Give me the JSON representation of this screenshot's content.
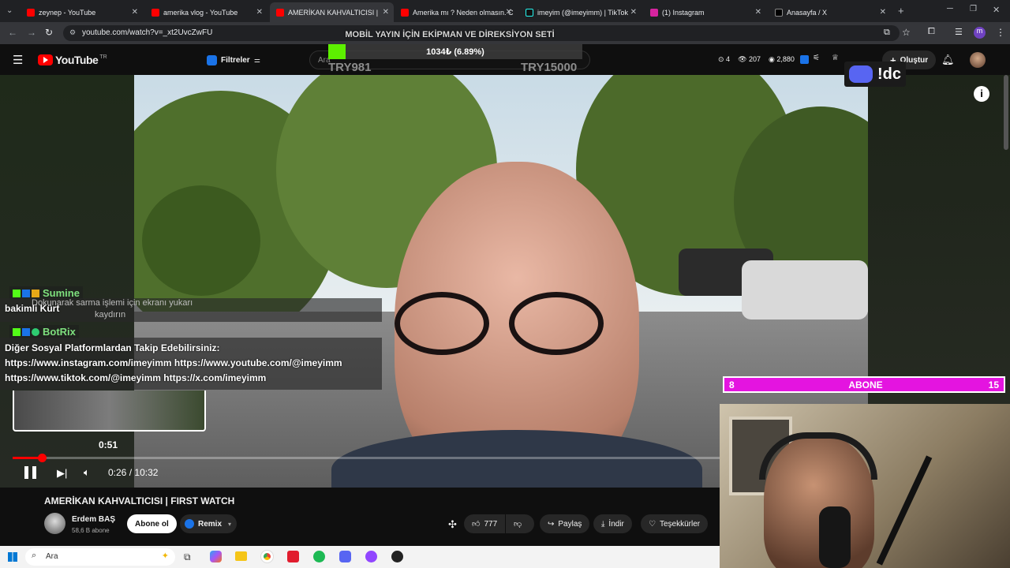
{
  "browser": {
    "tabs": [
      {
        "title": "zeynep - YouTube",
        "color": "#ff0000"
      },
      {
        "title": "amerika vlog - YouTube",
        "color": "#ff0000"
      },
      {
        "title": "AMERİKAN KAHVALTICISI |",
        "color": "#ff0000"
      },
      {
        "title": "Amerika mı ? Neden olmasın. C",
        "color": "#ff0000"
      },
      {
        "title": "imeyim (@imeyimm) | TikTok",
        "color": "#111111"
      },
      {
        "title": "(1) Instagram",
        "color": "#d6249f"
      },
      {
        "title": "Anasayfa / X",
        "color": "#000000"
      }
    ],
    "url": "youtube.com/watch?v=_xt2UvcZwFU"
  },
  "youtube": {
    "logo": "YouTube",
    "region": "TR",
    "filter_label": "Filtreler",
    "search_placeholder": "Ara",
    "stats": {
      "likes": "4",
      "views": "207",
      "viewers": "2,880"
    },
    "create_label": "Oluştur"
  },
  "stream_overlay": {
    "goal_title": "MOBİL YAYIN İÇİN EKİPMAN VE DİREKSİYON SETİ",
    "goal_progress_text": "1034₺ (6.89%)",
    "goal_progress": 0.0689,
    "goal_min": "TRY981",
    "goal_max": "TRY15000",
    "discord_label": "!dc",
    "sub_bar": {
      "left": "8",
      "label": "ABONE",
      "right": "15"
    }
  },
  "chat": {
    "user1": "Sumine",
    "hint": "Ekranı sarma işlemi için ekranı yukarı kaydırın",
    "hint_line1": "Dokunarak sarma işlemi için ekranı yukarı",
    "hint_line2": "kaydırın",
    "msg1": "bakimli Kürt",
    "user2": "BotRix",
    "msg2_line1": "Diğer Sosyal Platformlardan Takip Edebilirsiniz:",
    "msg2_line2": "https://www.instagram.com/imeyimm https://www.youtube.com/@imeyimm",
    "msg2_line3": "https://www.tiktok.com/@imeyimm https://x.com/imeyimm"
  },
  "player": {
    "preview_time": "0:51",
    "current_time": "0:26",
    "separator": "/",
    "duration": "10:32",
    "progress": 0.041
  },
  "video_info": {
    "title": "AMERİKAN KAHVALTICISI | FIRST WATCH",
    "channel": "Erdem BAŞ",
    "subscribers": "58,6 B abone",
    "subscribe_label": "Abone ol",
    "remix_label": "Remix",
    "like_count": "777",
    "share_label": "Paylaş",
    "download_label": "İndir",
    "thanks_label": "Teşekkürler"
  },
  "taskbar": {
    "search_placeholder": "Ara"
  }
}
